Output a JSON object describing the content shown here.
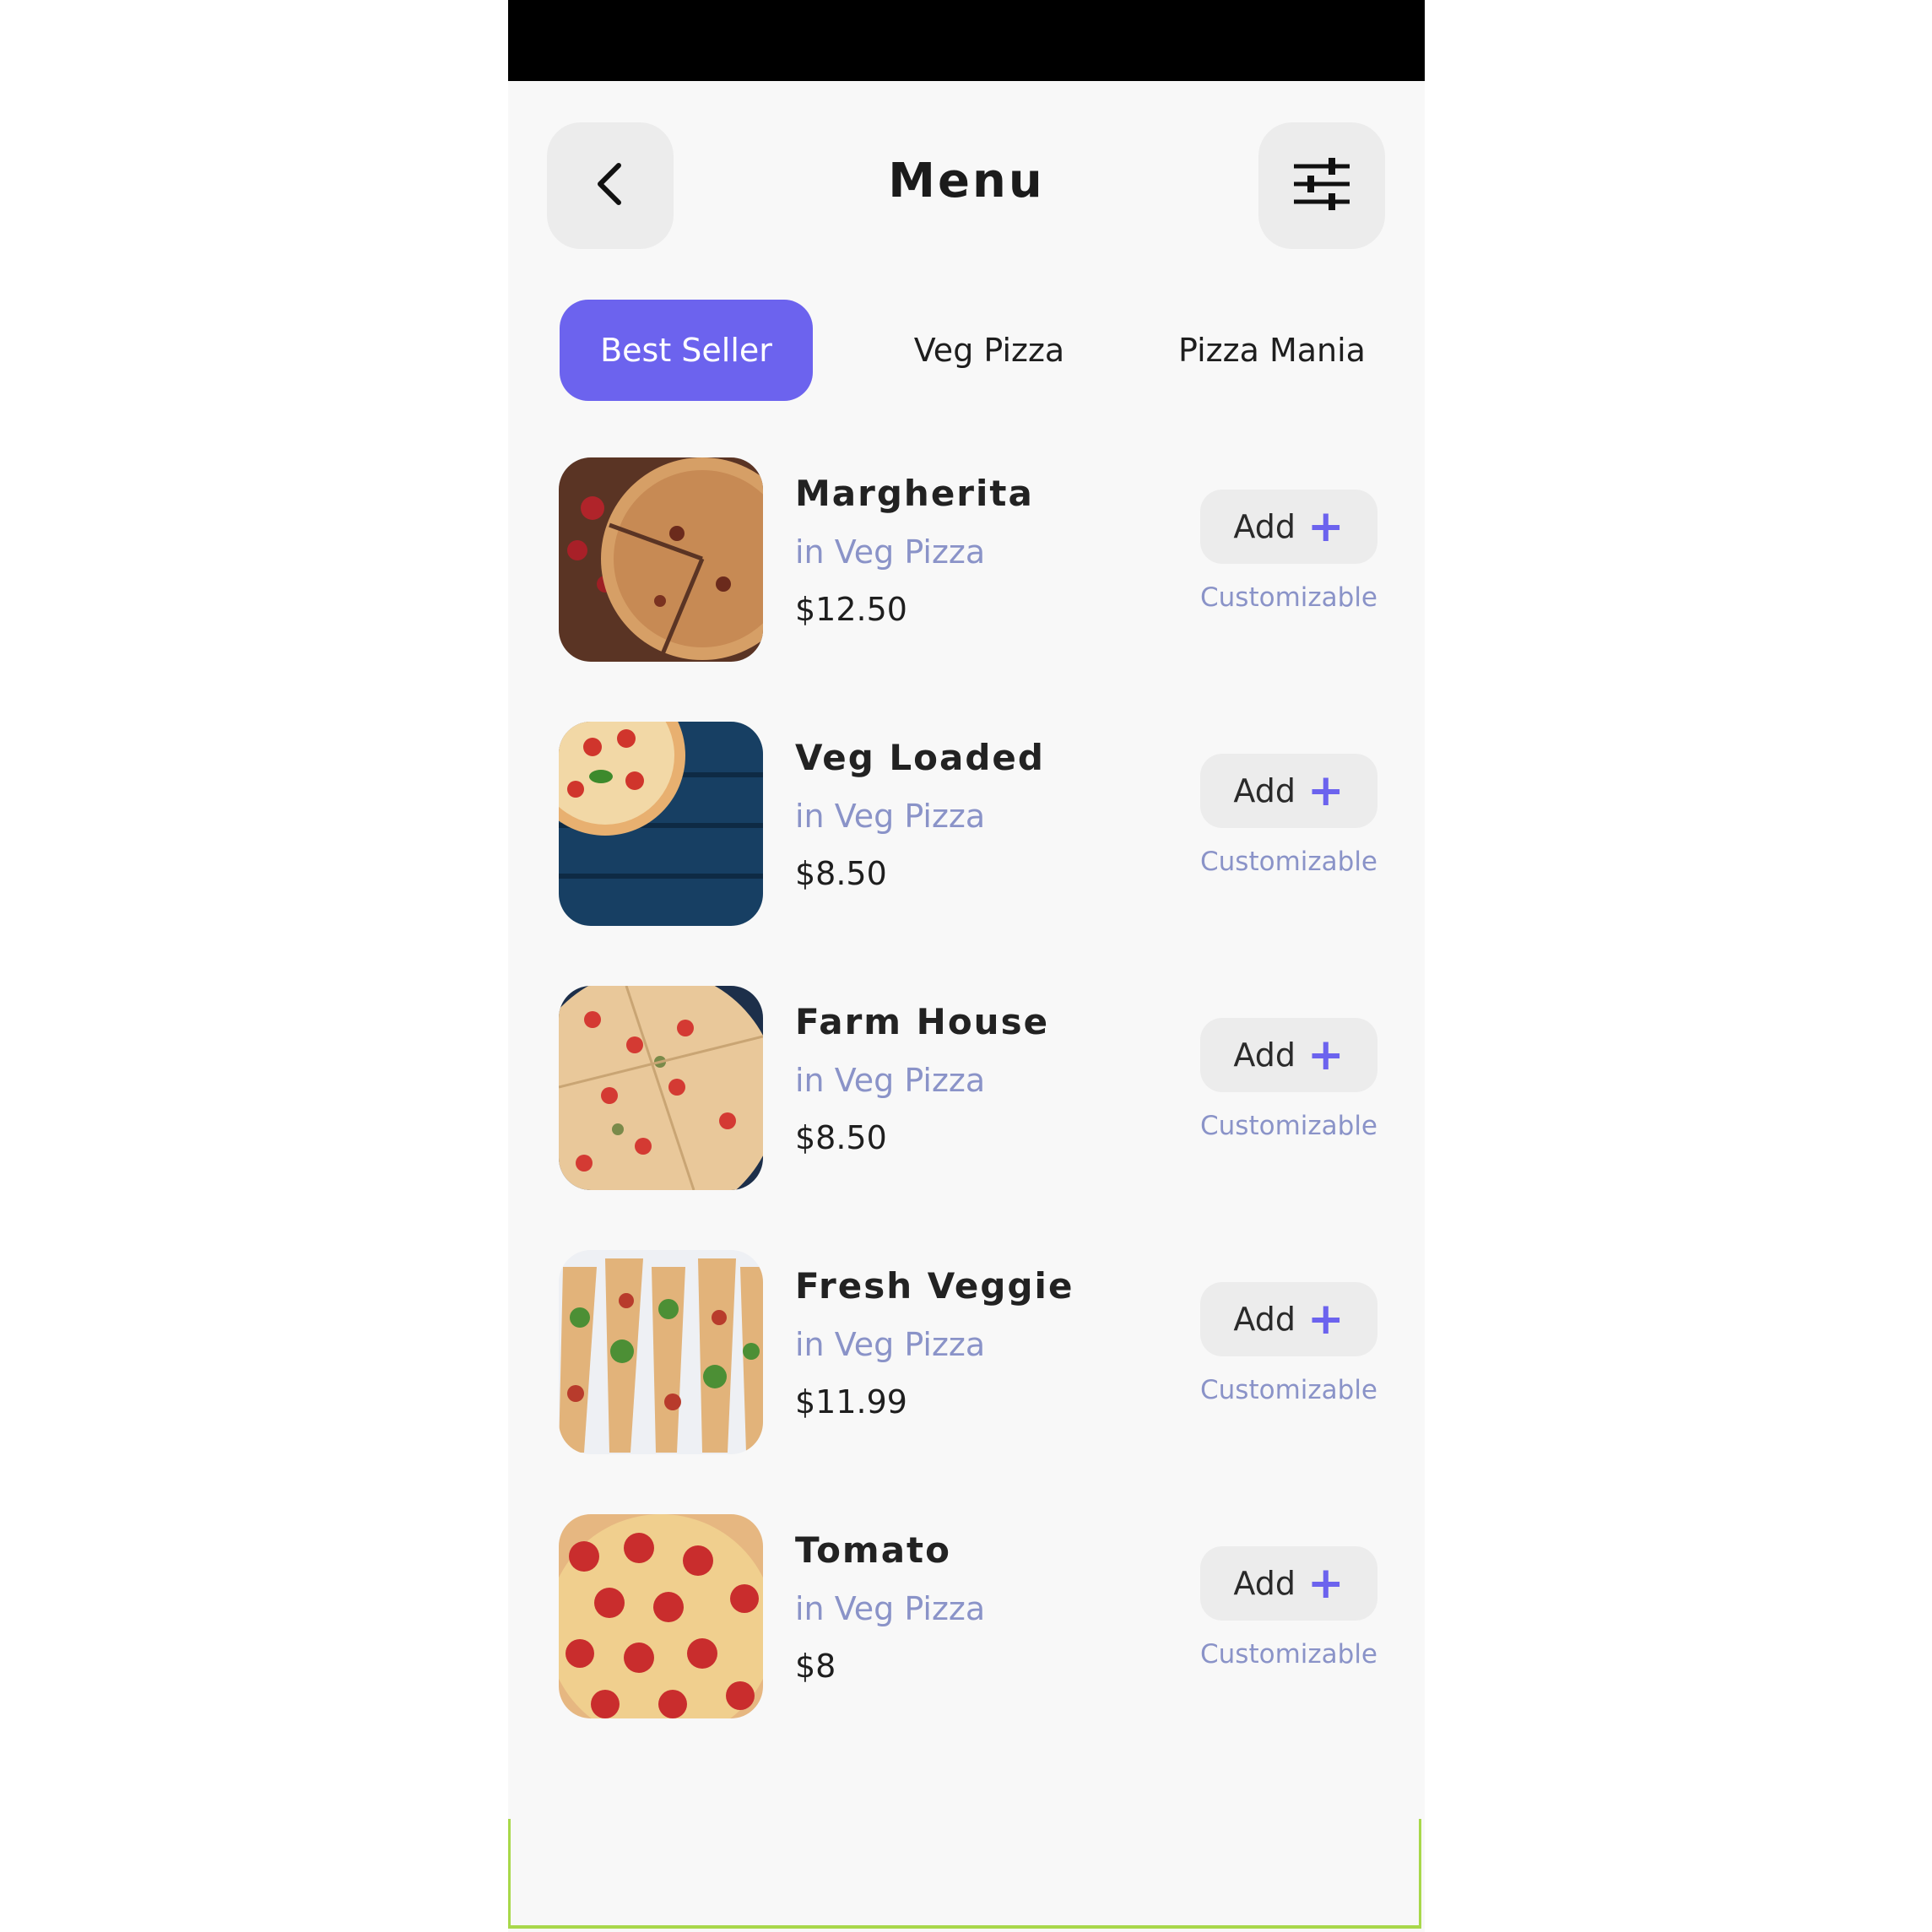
{
  "header": {
    "title": "Menu",
    "back_icon": "chevron-left-icon",
    "filter_icon": "sliders-icon"
  },
  "tabs": [
    {
      "label": "Best Seller",
      "active": true
    },
    {
      "label": "Veg Pizza",
      "active": false
    },
    {
      "label": "Pizza Mania",
      "active": false
    }
  ],
  "items": [
    {
      "name": "Margherita",
      "category": "in Veg Pizza",
      "price": "$12.50",
      "add_label": "Add",
      "customizable": "Customizable"
    },
    {
      "name": "Veg Loaded",
      "category": "in Veg Pizza",
      "price": "$8.50",
      "add_label": "Add",
      "customizable": "Customizable"
    },
    {
      "name": "Farm House",
      "category": "in Veg Pizza",
      "price": "$8.50",
      "add_label": "Add",
      "customizable": "Customizable"
    },
    {
      "name": "Fresh Veggie",
      "category": "in Veg Pizza",
      "price": "$11.99",
      "add_label": "Add",
      "customizable": "Customizable"
    },
    {
      "name": "Tomato",
      "category": "in Veg Pizza",
      "price": "$8",
      "add_label": "Add",
      "customizable": "Customizable"
    }
  ],
  "colors": {
    "accent": "#6c63ee",
    "category_text": "#8a93c8",
    "background": "#f8f8f8",
    "button_bg": "#ececec"
  }
}
